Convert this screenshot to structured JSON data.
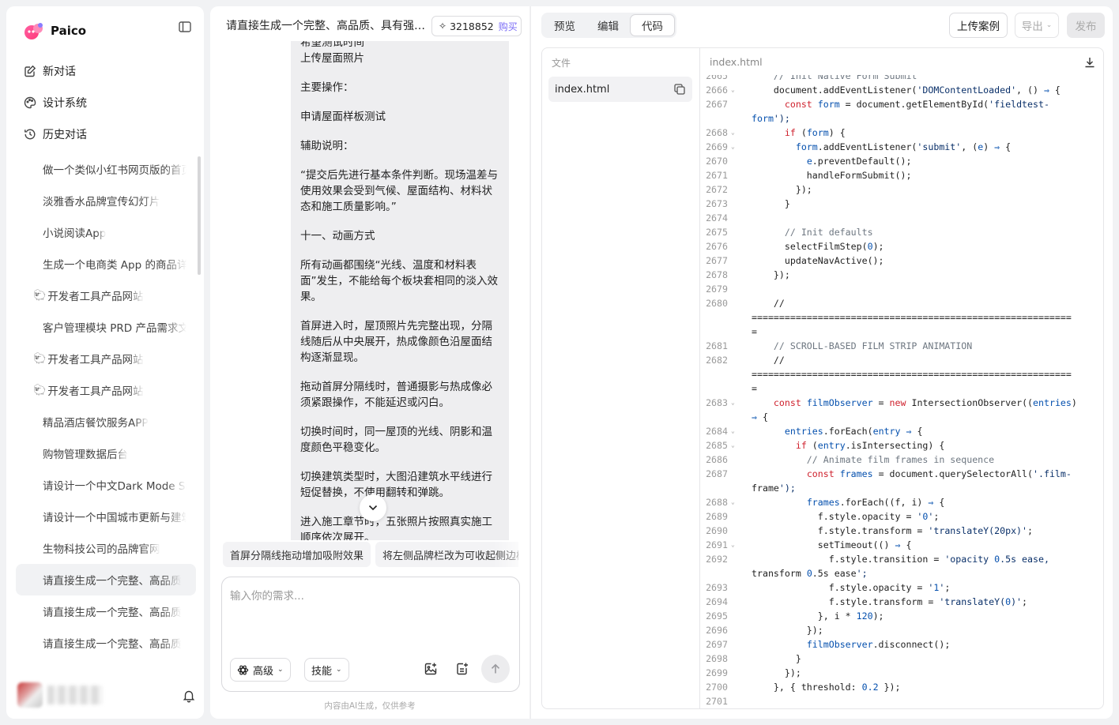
{
  "sidebar": {
    "brand": "Paico",
    "nav": [
      {
        "label": "新对话",
        "icon": "edit-icon"
      },
      {
        "label": "设计系统",
        "icon": "palette-icon"
      },
      {
        "label": "历史对话",
        "icon": "history-icon"
      }
    ],
    "history": [
      {
        "label": "做一个类似小红书网页版的首页",
        "emoji": ""
      },
      {
        "label": "淡雅香水品牌宣传幻灯片",
        "emoji": ""
      },
      {
        "label": "小说阅读App",
        "emoji": ""
      },
      {
        "label": "生成一个电商类 App 的商品详情页",
        "emoji": ""
      },
      {
        "label": "开发者工具产品网站",
        "emoji": "🐑"
      },
      {
        "label": "客户管理模块 PRD 产品需求文档",
        "emoji": ""
      },
      {
        "label": "开发者工具产品网站",
        "emoji": "🐑"
      },
      {
        "label": "开发者工具产品网站",
        "emoji": "🐑"
      },
      {
        "label": "精品酒店餐饮服务APP",
        "emoji": ""
      },
      {
        "label": "购物管理数据后台",
        "emoji": ""
      },
      {
        "label": "请设计一个中文Dark Mode SaaS",
        "emoji": ""
      },
      {
        "label": "请设计一个中国城市更新与建筑",
        "emoji": ""
      },
      {
        "label": "生物科技公司的品牌官网",
        "emoji": ""
      },
      {
        "label": "请直接生成一个完整、高品质",
        "emoji": "",
        "active": true
      },
      {
        "label": "请直接生成一个完整、高品质",
        "emoji": ""
      },
      {
        "label": "请直接生成一个完整、高品质",
        "emoji": ""
      }
    ]
  },
  "chat": {
    "title": "请直接生成一个完整、高品质、具有强烈视觉冲击力的",
    "credits": "3218852",
    "buy_label": "购买",
    "message": [
      {
        "text": "希望测试时间",
        "tight": true
      },
      {
        "text": "上传屋面照片"
      },
      {
        "text": "主要操作："
      },
      {
        "text": "申请屋面样板测试"
      },
      {
        "text": "辅助说明："
      },
      {
        "text": "“提交后先进行基本条件判断。现场温差与使用效果会受到气候、屋面结构、材料状态和施工质量影响。”"
      },
      {
        "text": "十一、动画方式"
      },
      {
        "text": "所有动画都围绕“光线、温度和材料表面”发生，不能给每个板块套相同的淡入效果。"
      },
      {
        "text": "首屏进入时，屋顶照片先完整出现，分隔线随后从中央展开，热成像颜色沿屋面结构逐渐显现。"
      },
      {
        "text": "拖动首屏分隔线时，普通摄影与热成像必须紧跟操作，不能延迟或闪白。"
      },
      {
        "text": "切换时间时，同一屋顶的光线、阴影和温度颜色平稳变化。"
      },
      {
        "text": "切换建筑类型时，大图沿建筑水平线进行短促替换，不使用翻转和弹跳。"
      },
      {
        "text": "进入施工章节时，五张照片按照真实施工顺序依次展开。"
      }
    ],
    "suggestions": [
      "首屏分隔线拖动增加吸附效果",
      "将左侧品牌栏改为可收起侧边栏"
    ],
    "input_placeholder": "输入你的需求...",
    "mode_label": "高级",
    "skills_label": "技能",
    "disclaimer": "内容由AI生成，仅供参考"
  },
  "code_panel": {
    "tabs": [
      {
        "label": "预览",
        "active": false
      },
      {
        "label": "编辑",
        "active": false
      },
      {
        "label": "代码",
        "active": true
      }
    ],
    "upload_label": "上传案例",
    "export_label": "导出",
    "publish_label": "发布",
    "files_label": "文件",
    "file_name": "index.html",
    "editor_title": "index.html"
  },
  "code": [
    {
      "n": "2665",
      "t": "    // Init Native Form Submit",
      "fold": false
    },
    {
      "n": "2666",
      "t": "    document.addEventListener('DOMContentLoaded', () ⇒ {",
      "fold": true
    },
    {
      "n": "2667",
      "t": "      const form = document.getElementById('fieldtest-",
      "fold": false
    },
    {
      "n": "",
      "t": "form');",
      "fold": false,
      "wrap": true
    },
    {
      "n": "2668",
      "t": "      if (form) {",
      "fold": true
    },
    {
      "n": "2669",
      "t": "        form.addEventListener('submit', (e) ⇒ {",
      "fold": true
    },
    {
      "n": "2670",
      "t": "          e.preventDefault();",
      "fold": false
    },
    {
      "n": "2671",
      "t": "          handleFormSubmit();",
      "fold": false
    },
    {
      "n": "2672",
      "t": "        });",
      "fold": false
    },
    {
      "n": "2673",
      "t": "      }",
      "fold": false
    },
    {
      "n": "2674",
      "t": "",
      "fold": false
    },
    {
      "n": "2675",
      "t": "      // Init defaults",
      "fold": false
    },
    {
      "n": "2676",
      "t": "      selectFilmStep(0);",
      "fold": false
    },
    {
      "n": "2677",
      "t": "      updateNavActive();",
      "fold": false
    },
    {
      "n": "2678",
      "t": "    });",
      "fold": false
    },
    {
      "n": "2679",
      "t": "",
      "fold": false
    },
    {
      "n": "2680",
      "t": "    //",
      "fold": false
    },
    {
      "n": "",
      "t": "==========================================================",
      "fold": false,
      "wrap": true
    },
    {
      "n": "",
      "t": "=",
      "fold": false,
      "wrap": true
    },
    {
      "n": "2681",
      "t": "    // SCROLL-BASED FILM STRIP ANIMATION",
      "fold": false
    },
    {
      "n": "2682",
      "t": "    //",
      "fold": false
    },
    {
      "n": "",
      "t": "==========================================================",
      "fold": false,
      "wrap": true
    },
    {
      "n": "",
      "t": "=",
      "fold": false,
      "wrap": true
    },
    {
      "n": "2683",
      "t": "    const filmObserver = new IntersectionObserver((entries)",
      "fold": true
    },
    {
      "n": "",
      "t": "⇒ {",
      "fold": false,
      "wrap": true
    },
    {
      "n": "2684",
      "t": "      entries.forEach(entry ⇒ {",
      "fold": true
    },
    {
      "n": "2685",
      "t": "        if (entry.isIntersecting) {",
      "fold": true
    },
    {
      "n": "2686",
      "t": "          // Animate film frames in sequence",
      "fold": false
    },
    {
      "n": "2687",
      "t": "          const frames = document.querySelectorAll('.film-",
      "fold": false
    },
    {
      "n": "",
      "t": "frame');",
      "fold": false,
      "wrap": true
    },
    {
      "n": "2688",
      "t": "          frames.forEach((f, i) ⇒ {",
      "fold": true
    },
    {
      "n": "2689",
      "t": "            f.style.opacity = '0';",
      "fold": false
    },
    {
      "n": "2690",
      "t": "            f.style.transform = 'translateY(20px)';",
      "fold": false
    },
    {
      "n": "2691",
      "t": "            setTimeout(() ⇒ {",
      "fold": true
    },
    {
      "n": "2692",
      "t": "              f.style.transition = 'opacity 0.5s ease,",
      "fold": false
    },
    {
      "n": "",
      "t": "transform 0.5s ease';",
      "fold": false,
      "wrap": true
    },
    {
      "n": "2693",
      "t": "              f.style.opacity = '1';",
      "fold": false
    },
    {
      "n": "2694",
      "t": "              f.style.transform = 'translateY(0)';",
      "fold": false
    },
    {
      "n": "2695",
      "t": "            }, i * 120);",
      "fold": false
    },
    {
      "n": "2696",
      "t": "          });",
      "fold": false
    },
    {
      "n": "2697",
      "t": "          filmObserver.disconnect();",
      "fold": false
    },
    {
      "n": "2698",
      "t": "        }",
      "fold": false
    },
    {
      "n": "2699",
      "t": "      });",
      "fold": false
    },
    {
      "n": "2700",
      "t": "    }, { threshold: 0.2 });",
      "fold": false
    },
    {
      "n": "2701",
      "t": "",
      "fold": false
    }
  ]
}
